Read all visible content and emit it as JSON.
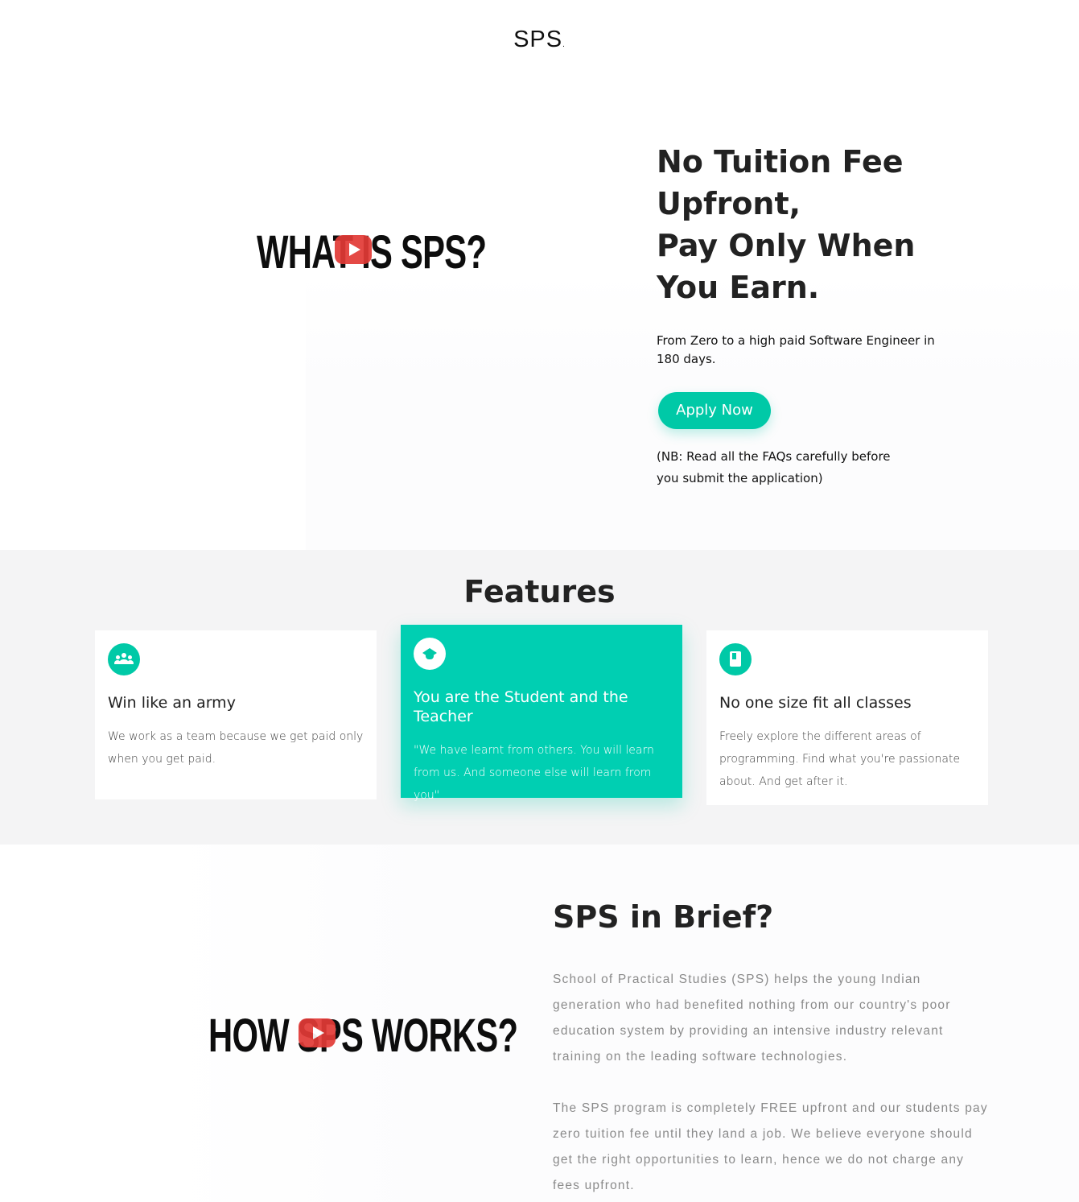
{
  "header": {
    "logo": "SPS",
    "logo_dot": "."
  },
  "hero": {
    "video_title": "WHAT IS SPS?",
    "title_lines": [
      "No Tuition Fee",
      "Upfront,",
      "Pay Only When",
      "You Earn."
    ],
    "subtitle": "From Zero to a high paid Software Engineer in 180 days.",
    "apply_label": "Apply Now",
    "note": "(NB: Read all the FAQs carefully before you submit the application)"
  },
  "features": {
    "title": "Features",
    "cards": [
      {
        "icon": "people-icon",
        "title": "Win like an army",
        "text": "We work as a team because we get paid only when you get paid."
      },
      {
        "icon": "graduation-cap-icon",
        "title": "You are the Student and the Teacher",
        "text": "\"We have learnt from others. You will learn from us. And someone else will learn from you\""
      },
      {
        "icon": "book-icon",
        "title": "No one size fit all classes",
        "text": "Freely explore the different areas of programming. Find what you're passionate about. And get after it."
      }
    ]
  },
  "brief": {
    "video_title": "HOW SPS WORKS?",
    "title": "SPS in Brief?",
    "paragraphs": [
      "School of Practical Studies (SPS) helps the young Indian generation who had benefited nothing from our country's poor education system by providing an intensive industry relevant training on the leading software technologies.",
      "The SPS program is completely FREE upfront and our students pay zero tuition fee until they land a job. We believe everyone should get the right opportunities to learn, hence we do not charge any fees upfront."
    ]
  },
  "colors": {
    "accent": "#00c9a7",
    "youtube_red": "#e23a36",
    "section_bg": "#f4f4f5"
  }
}
